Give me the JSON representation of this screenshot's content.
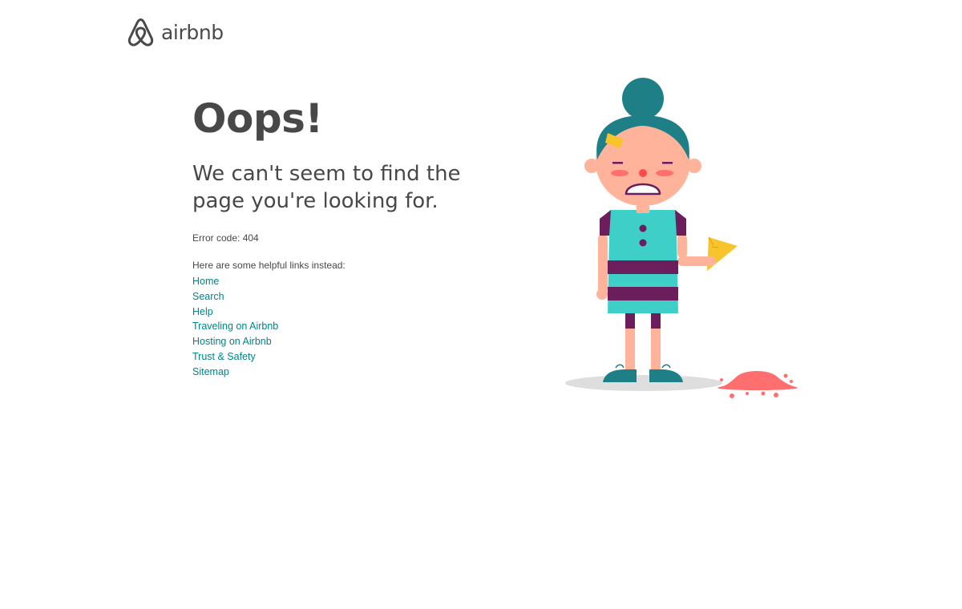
{
  "brand": {
    "wordmark": "airbnb",
    "logo_icon": "airbnb-belo-icon",
    "color": "#4a4a4a"
  },
  "main": {
    "headline": "Oops!",
    "subhead_line1": "We can't seem to find the",
    "subhead_line2": "page you're looking for.",
    "error_code": "Error code: 404",
    "links_intro": "Here are some helpful links instead:",
    "links": [
      {
        "label": "Home"
      },
      {
        "label": "Search"
      },
      {
        "label": "Help"
      },
      {
        "label": "Traveling on Airbnb"
      },
      {
        "label": "Hosting on Airbnb"
      },
      {
        "label": "Trust & Safety"
      },
      {
        "label": "Sitemap"
      }
    ]
  },
  "colors": {
    "text": "#484848",
    "link": "#00848a",
    "hair": "#1e7f87",
    "dress": "#3ecfc9",
    "stripes": "#6b1d5c",
    "skin": "#ffb39a",
    "ice_cream": "#ff6f6f",
    "cone": "#f7c42c"
  },
  "illustration": {
    "name": "crying-girl-dropped-ice-cream"
  }
}
